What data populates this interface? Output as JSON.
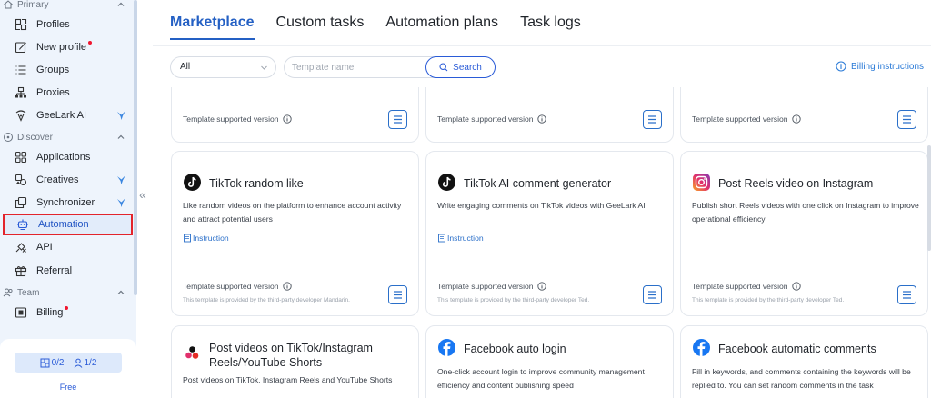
{
  "sidebar": {
    "sections": {
      "primary": "Primary",
      "discover": "Discover",
      "team": "Team"
    },
    "items": {
      "profiles": "Profiles",
      "new_profile": "New profile",
      "groups": "Groups",
      "proxies": "Proxies",
      "geelark_ai": "GeeLark AI",
      "applications": "Applications",
      "creatives": "Creatives",
      "synchronizer": "Synchronizer",
      "automation": "Automation",
      "api": "API",
      "referral": "Referral",
      "billing": "Billing"
    },
    "plan": {
      "profiles_quota": "0/2",
      "members_quota": "1/2",
      "plan_name": "Free"
    },
    "collapse_glyph": "«"
  },
  "tabs": [
    "Marketplace",
    "Custom tasks",
    "Automation plans",
    "Task logs"
  ],
  "filters": {
    "category_value": "All",
    "search_placeholder": "Template name",
    "search_label": "Search",
    "billing_link": "Billing instructions"
  },
  "cards": {
    "top_row": [
      {
        "version_label": "Template supported version"
      },
      {
        "version_label": "Template supported version"
      },
      {
        "version_label": "Template supported version"
      }
    ],
    "mid_row": [
      {
        "title": "TikTok random like",
        "desc": "Like random videos on the platform to enhance account activity and attract potential users",
        "instruction": "Instruction",
        "version_label": "Template supported version",
        "provider": "This template is provided by the third-party developer Mandarin."
      },
      {
        "title": "TikTok AI comment generator",
        "desc": "Write engaging comments on TikTok videos with GeeLark AI",
        "instruction": "Instruction",
        "version_label": "Template supported version",
        "provider": "This template is provided by the third-party developer Ted."
      },
      {
        "title": "Post Reels video on Instagram",
        "desc": "Publish short Reels videos with one click on Instagram to improve operational efficiency",
        "version_label": "Template supported version",
        "provider": "This template is provided by the third-party developer Ted."
      }
    ],
    "bottom_row": [
      {
        "title": "Post videos on TikTok/Instagram Reels/YouTube Shorts",
        "desc": "Post videos on TikTok, Instagram Reels and YouTube Shorts"
      },
      {
        "title": "Facebook auto login",
        "desc": "One-click account login to improve community management efficiency and content publishing speed"
      },
      {
        "title": "Facebook automatic comments",
        "desc": "Fill in keywords, and comments containing the keywords will be replied to. You can set random comments in the task"
      }
    ]
  },
  "colors": {
    "accent": "#2460c4",
    "active_outline": "#e3242b",
    "sidebar_bg": "#eef4fc",
    "notification_dot": "#f0162f"
  }
}
